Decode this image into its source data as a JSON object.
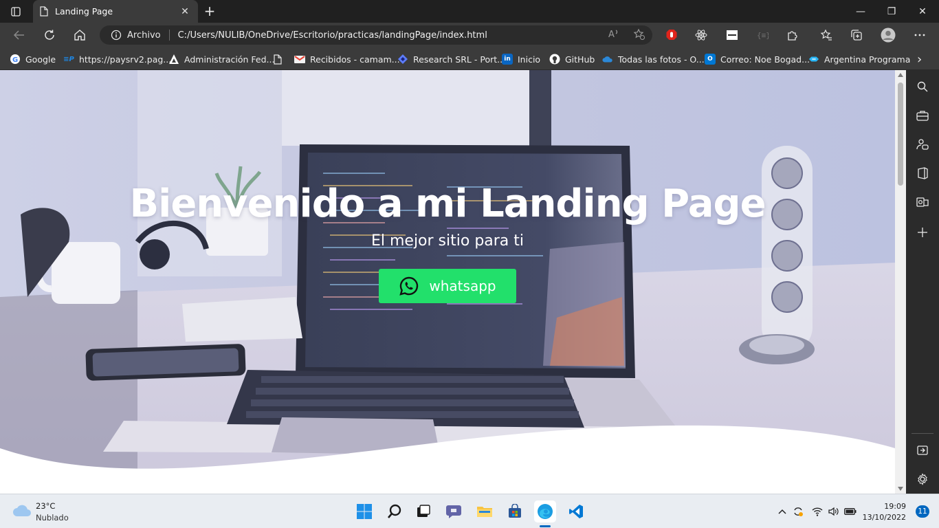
{
  "browser": {
    "tab": {
      "title": "Landing Page",
      "close": "✕"
    },
    "new_tab": "+",
    "window": {
      "minimize": "—",
      "maximize": "❐",
      "close": "✕"
    },
    "address": {
      "site_info_label": "Archivo",
      "url": "C:/Users/NULIB/OneDrive/Escritorio/practicas/landingPage/index.html"
    },
    "bookmarks": [
      {
        "label": "Google",
        "icon": "google-icon",
        "color": "#4285f4"
      },
      {
        "label": "https://paysrv2.pag...",
        "icon": "paysrv-icon",
        "color": "#1e88e5"
      },
      {
        "label": "Administración Fed...",
        "icon": "afip-icon",
        "color": "#ffffff"
      },
      {
        "label": "",
        "icon": "page-icon",
        "color": "#ffffff"
      },
      {
        "label": "Recibidos - camam...",
        "icon": "gmail-icon",
        "color": "#ea4335"
      },
      {
        "label": "Research SRL - Port...",
        "icon": "research-icon",
        "color": "#5c7cfa"
      },
      {
        "label": "Inicio",
        "icon": "linkedin-icon",
        "color": "#0a66c2"
      },
      {
        "label": "GitHub",
        "icon": "github-icon",
        "color": "#ffffff"
      },
      {
        "label": "Todas las fotos - O...",
        "icon": "onedrive-icon",
        "color": "#2b88d8"
      },
      {
        "label": "Correo: Noe Bogad...",
        "icon": "outlook-icon",
        "color": "#0078d4"
      },
      {
        "label": "Argentina Programa",
        "icon": "argprog-icon",
        "color": "#29b6f6"
      }
    ],
    "bookmarks_more": "›"
  },
  "page": {
    "title": "Bienvenido a mi Landing Page",
    "subtitle": "El mejor sitio para ti",
    "button_label": "whatsapp",
    "button_color": "#22e06b"
  },
  "taskbar": {
    "weather": {
      "temp": "23°C",
      "status": "Nublado"
    },
    "clock": {
      "time": "19:09",
      "date": "13/10/2022"
    },
    "notifications": "11"
  }
}
